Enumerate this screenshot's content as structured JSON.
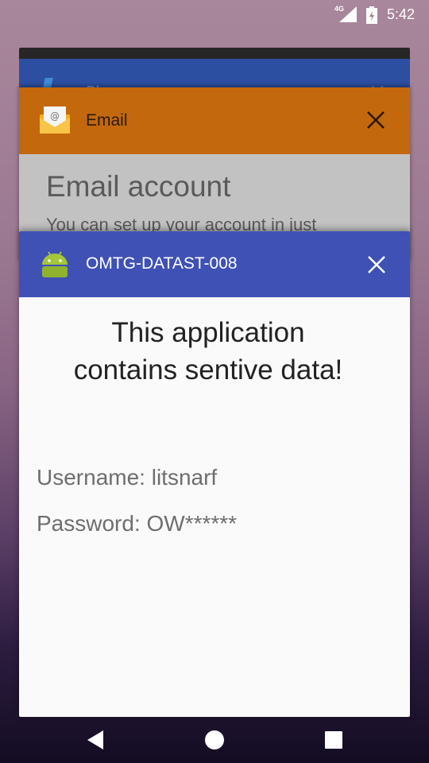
{
  "status_bar": {
    "network": "4G",
    "time": "5:42"
  },
  "recents": {
    "phone_card": {
      "title": "Phone"
    },
    "email_card": {
      "app_name": "Email",
      "content_title": "Email account",
      "content_subtitle": "You can set up your account in just"
    },
    "main_card": {
      "app_name": "OMTG-DATAST-008",
      "heading_line1": "This application",
      "heading_line2": "contains sentive data!",
      "username_label": "Username: litsnarf",
      "password_label": "Password: OW******"
    }
  },
  "colors": {
    "email_header": "#c3680d",
    "main_header": "#3f51b5",
    "phone_header": "#2d4fa2"
  },
  "icons": {
    "email": "email-envelope-icon",
    "main": "android-robot-icon",
    "close": "close-icon",
    "back": "back-icon",
    "home": "home-icon",
    "recents": "recents-icon"
  }
}
